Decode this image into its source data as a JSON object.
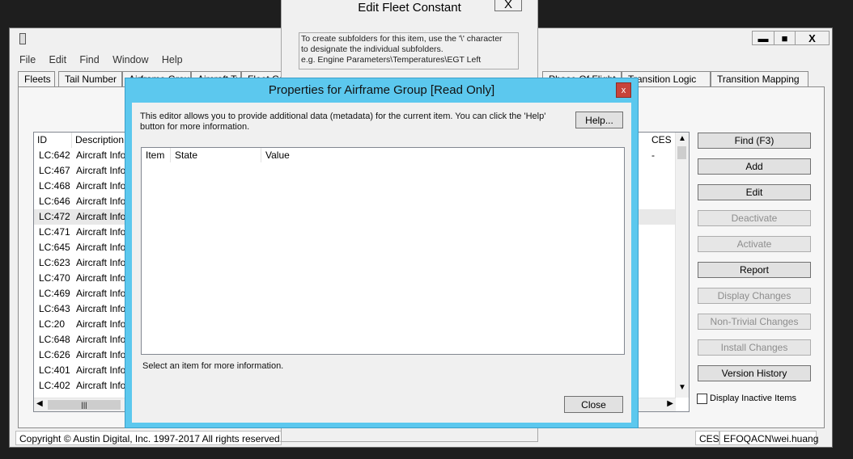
{
  "main_window": {
    "controls": {
      "minimize": "▬",
      "maximize": "■",
      "close": "X"
    },
    "menu": [
      "File",
      "Edit",
      "Find",
      "Window",
      "Help"
    ],
    "tabs": [
      "Fleets",
      "Tail Number",
      "Airframe Group",
      "Aircraft Type",
      "Fleet Group",
      "Phase Of Flight",
      "Transition Logic",
      "Transition Mapping"
    ],
    "list": {
      "headers": {
        "id": "ID",
        "description": "Description",
        "ces": "CES -"
      },
      "rows": [
        {
          "id": "LC:642",
          "desc": "Aircraft Info"
        },
        {
          "id": "LC:467",
          "desc": "Aircraft Info"
        },
        {
          "id": "LC:468",
          "desc": "Aircraft Info"
        },
        {
          "id": "LC:646",
          "desc": "Aircraft Info"
        },
        {
          "id": "LC:472",
          "desc": "Aircraft Info"
        },
        {
          "id": "LC:471",
          "desc": "Aircraft Info"
        },
        {
          "id": "LC:645",
          "desc": "Aircraft Info"
        },
        {
          "id": "LC:623",
          "desc": "Aircraft Info"
        },
        {
          "id": "LC:470",
          "desc": "Aircraft Info"
        },
        {
          "id": "LC:469",
          "desc": "Aircraft Info"
        },
        {
          "id": "LC:643",
          "desc": "Aircraft Info"
        },
        {
          "id": "LC:20",
          "desc": "Aircraft Info"
        },
        {
          "id": "LC:648",
          "desc": "Aircraft Info"
        },
        {
          "id": "LC:626",
          "desc": "Aircraft Info"
        },
        {
          "id": "LC:401",
          "desc": "Aircraft Info"
        },
        {
          "id": "LC:402",
          "desc": "Aircraft Info"
        }
      ]
    },
    "buttons": {
      "find": "Find  (F3)",
      "add": "Add",
      "edit": "Edit",
      "deactivate": "Deactivate",
      "activate": "Activate",
      "report": "Report",
      "display_changes": "Display Changes",
      "non_trivial_changes": "Non-Trivial Changes",
      "install_changes": "Install Changes",
      "version_history": "Version History"
    },
    "display_inactive_label": "Display Inactive Items",
    "status": {
      "copyright": "Copyright © Austin Digital, Inc. 1997-2017 All rights reserved.",
      "db": "CES",
      "user": "EFOQACN\\wei.huang"
    }
  },
  "fleet_dialog": {
    "title": "Edit Fleet Constant",
    "close": "X",
    "hint_lines": [
      "To create subfolders for this item, use the '\\' character",
      "to designate the individual subfolders.",
      "e.g.  Engine Parameters\\Temperatures\\EGT Left"
    ]
  },
  "properties_dialog": {
    "title": "Properties for Airframe Group [Read Only]",
    "close": "x",
    "description_lines": [
      "This editor allows you to provide additional data (metadata) for the current item. You can click the 'Help'",
      "button for more information."
    ],
    "help_button": "Help...",
    "columns": {
      "item": "Item",
      "state": "State",
      "value": "Value"
    },
    "hint": "Select an item for more information.",
    "close_button": "Close"
  }
}
